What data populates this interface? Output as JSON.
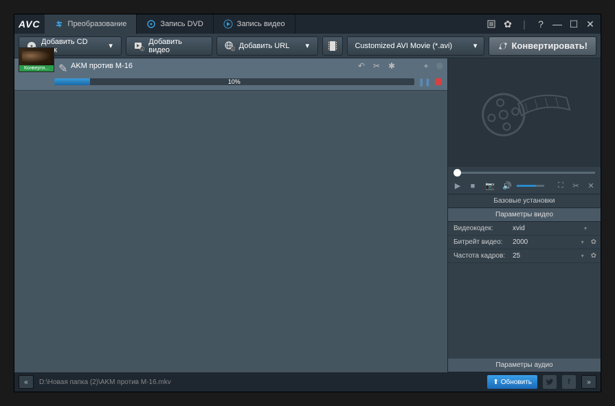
{
  "logo": "AVC",
  "tabs": [
    {
      "label": "Преобразование",
      "icon": "convert"
    },
    {
      "label": "Запись DVD",
      "icon": "dvd"
    },
    {
      "label": "Запись видео",
      "icon": "play"
    }
  ],
  "toolbar": {
    "add_cd": "Добавить CD диск",
    "add_video": "Добавить видео",
    "add_url": "Добавить URL",
    "format_selected": "Customized AVI Movie (*.avi)",
    "convert": "Конвертировать!"
  },
  "file": {
    "name": "AKM против M-16",
    "thumb_label": "Конверти...",
    "progress_pct": 10,
    "progress_text": "10%"
  },
  "settings": {
    "basic_header": "Базовые установки",
    "video_header": "Параметры видео",
    "audio_header": "Параметры аудио",
    "rows": [
      {
        "label": "Видеокодек:",
        "value": "xvid",
        "gear": false
      },
      {
        "label": "Битрейт видео:",
        "value": "2000",
        "gear": true
      },
      {
        "label": "Частота кадров:",
        "value": "25",
        "gear": true
      }
    ]
  },
  "statusbar": {
    "path": "D:\\Новая папка (2)\\AKM против M-16.mkv",
    "update": "Обновить"
  }
}
